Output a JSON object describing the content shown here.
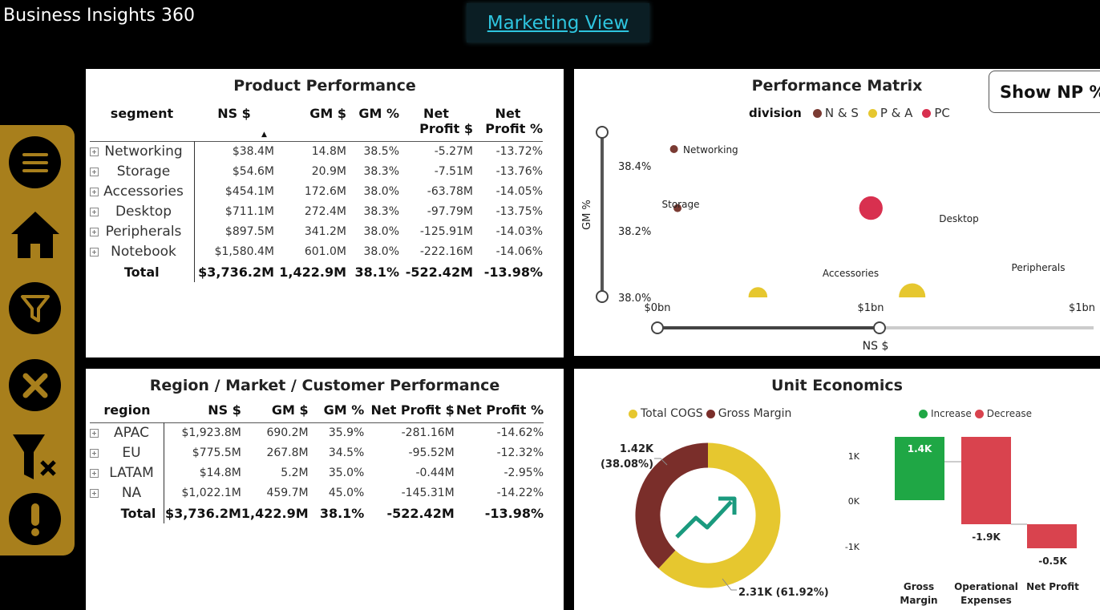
{
  "app": {
    "title": "Business Insights 360",
    "view_button": "Marketing View"
  },
  "colors": {
    "ns": "#7a3b33",
    "pa": "#e6c72f",
    "pc": "#d8304f",
    "sidebar": "#a87f1c",
    "increase": "#1fa745",
    "decrease": "#d9434e"
  },
  "sidebar": {
    "icons": [
      "menu-icon",
      "home-icon",
      "filter-icon",
      "close-icon",
      "clear-filter-icon",
      "alert-icon"
    ]
  },
  "product": {
    "title": "Product Performance",
    "headers": {
      "segment": "segment",
      "ns": "NS $",
      "gm": "GM $",
      "gmp": "GM %",
      "np1": "Net",
      "np2": "Profit $",
      "npp1": "Net",
      "npp2": "Profit %"
    },
    "rows": [
      {
        "name": "Networking",
        "ns": "$38.4M",
        "gm": "14.8M",
        "gmp": "38.5%",
        "np": "-5.27M",
        "npp": "-13.72%"
      },
      {
        "name": "Storage",
        "ns": "$54.6M",
        "gm": "20.9M",
        "gmp": "38.3%",
        "np": "-7.51M",
        "npp": "-13.76%"
      },
      {
        "name": "Accessories",
        "ns": "$454.1M",
        "gm": "172.6M",
        "gmp": "38.0%",
        "np": "-63.78M",
        "npp": "-14.05%"
      },
      {
        "name": "Desktop",
        "ns": "$711.1M",
        "gm": "272.4M",
        "gmp": "38.3%",
        "np": "-97.79M",
        "npp": "-13.75%"
      },
      {
        "name": "Peripherals",
        "ns": "$897.5M",
        "gm": "341.2M",
        "gmp": "38.0%",
        "np": "-125.91M",
        "npp": "-14.03%"
      },
      {
        "name": "Notebook",
        "ns": "$1,580.4M",
        "gm": "601.0M",
        "gmp": "38.0%",
        "np": "-222.16M",
        "npp": "-14.06%"
      }
    ],
    "total": {
      "name": "Total",
      "ns": "$3,736.2M",
      "gm": "1,422.9M",
      "gmp": "38.1%",
      "np": "-522.42M",
      "npp": "-13.98%"
    }
  },
  "matrix": {
    "title": "Performance Matrix",
    "button": "Show NP %",
    "legend_title": "division",
    "legend": [
      "N & S",
      "P & A",
      "PC"
    ],
    "y_label": "GM %",
    "x_label": "NS $",
    "y_ticks": [
      "38.4%",
      "38.2%",
      "38.0%"
    ],
    "x_ticks": [
      "$0bn",
      "$1bn",
      "$1bn"
    ],
    "points": [
      {
        "label": "Networking",
        "division": "N & S",
        "ns": 38.4,
        "gm": 38.5
      },
      {
        "label": "Storage",
        "division": "N & S",
        "ns": 54.6,
        "gm": 38.3
      },
      {
        "label": "Desktop",
        "division": "PC",
        "ns": 711.1,
        "gm": 38.3
      },
      {
        "label": "Accessories",
        "division": "P & A",
        "ns": 454.1,
        "gm": 38.0
      },
      {
        "label": "Peripherals",
        "division": "P & A",
        "ns": 897.5,
        "gm": 38.0
      }
    ]
  },
  "region": {
    "title": "Region / Market / Customer Performance",
    "headers": {
      "region": "region",
      "ns": "NS $",
      "gm": "GM $",
      "gmp": "GM %",
      "np": "Net Profit $",
      "npp": "Net Profit %"
    },
    "rows": [
      {
        "name": "APAC",
        "ns": "$1,923.8M",
        "gm": "690.2M",
        "gmp": "35.9%",
        "np": "-281.16M",
        "npp": "-14.62%"
      },
      {
        "name": "EU",
        "ns": "$775.5M",
        "gm": "267.8M",
        "gmp": "34.5%",
        "np": "-95.52M",
        "npp": "-12.32%"
      },
      {
        "name": "LATAM",
        "ns": "$14.8M",
        "gm": "5.2M",
        "gmp": "35.0%",
        "np": "-0.44M",
        "npp": "-2.95%"
      },
      {
        "name": "NA",
        "ns": "$1,022.1M",
        "gm": "459.7M",
        "gmp": "45.0%",
        "np": "-145.31M",
        "npp": "-14.22%"
      }
    ],
    "total": {
      "name": "Total",
      "ns": "$3,736.2M",
      "gm": "1,422.9M",
      "gmp": "38.1%",
      "np": "-522.42M",
      "npp": "-13.98%"
    }
  },
  "unit": {
    "title": "Unit Economics",
    "donut_legend": [
      "Total COGS",
      "Gross Margin"
    ],
    "donut_label_gm_1": "1.42K",
    "donut_label_gm_2": "(38.08%)",
    "donut_label_cogs": "2.31K (61.92%)",
    "waterfall_legend": [
      "Increase",
      "Decrease"
    ],
    "y_ticks": [
      "1K",
      "0K",
      "-1K"
    ],
    "bars": [
      {
        "category_1": "Gross",
        "category_2": "Margin",
        "label": "1.4K"
      },
      {
        "category_1": "Operational",
        "category_2": "Expenses",
        "label": "-1.9K"
      },
      {
        "category_1": "Net Profit",
        "category_2": "",
        "label": "-0.5K"
      }
    ]
  },
  "chart_data": [
    {
      "type": "scatter",
      "title": "Performance Matrix",
      "xlabel": "NS $",
      "ylabel": "GM %",
      "series": [
        {
          "name": "N & S",
          "points": [
            {
              "label": "Networking",
              "x": 38.4,
              "y": 38.5
            },
            {
              "label": "Storage",
              "x": 54.6,
              "y": 38.3
            }
          ]
        },
        {
          "name": "P & A",
          "points": [
            {
              "label": "Accessories",
              "x": 454.1,
              "y": 38.0
            },
            {
              "label": "Peripherals",
              "x": 897.5,
              "y": 38.0
            }
          ]
        },
        {
          "name": "PC",
          "points": [
            {
              "label": "Desktop",
              "x": 711.1,
              "y": 38.3
            }
          ]
        }
      ]
    },
    {
      "type": "pie",
      "categories": [
        "Total COGS",
        "Gross Margin"
      ],
      "values": [
        2310,
        1420
      ],
      "percent": [
        61.92,
        38.08
      ]
    },
    {
      "type": "bar",
      "categories": [
        "Gross Margin",
        "Operational Expenses",
        "Net Profit"
      ],
      "values": [
        1400,
        -1900,
        -500
      ],
      "legend": [
        "Increase",
        "Decrease"
      ]
    }
  ]
}
